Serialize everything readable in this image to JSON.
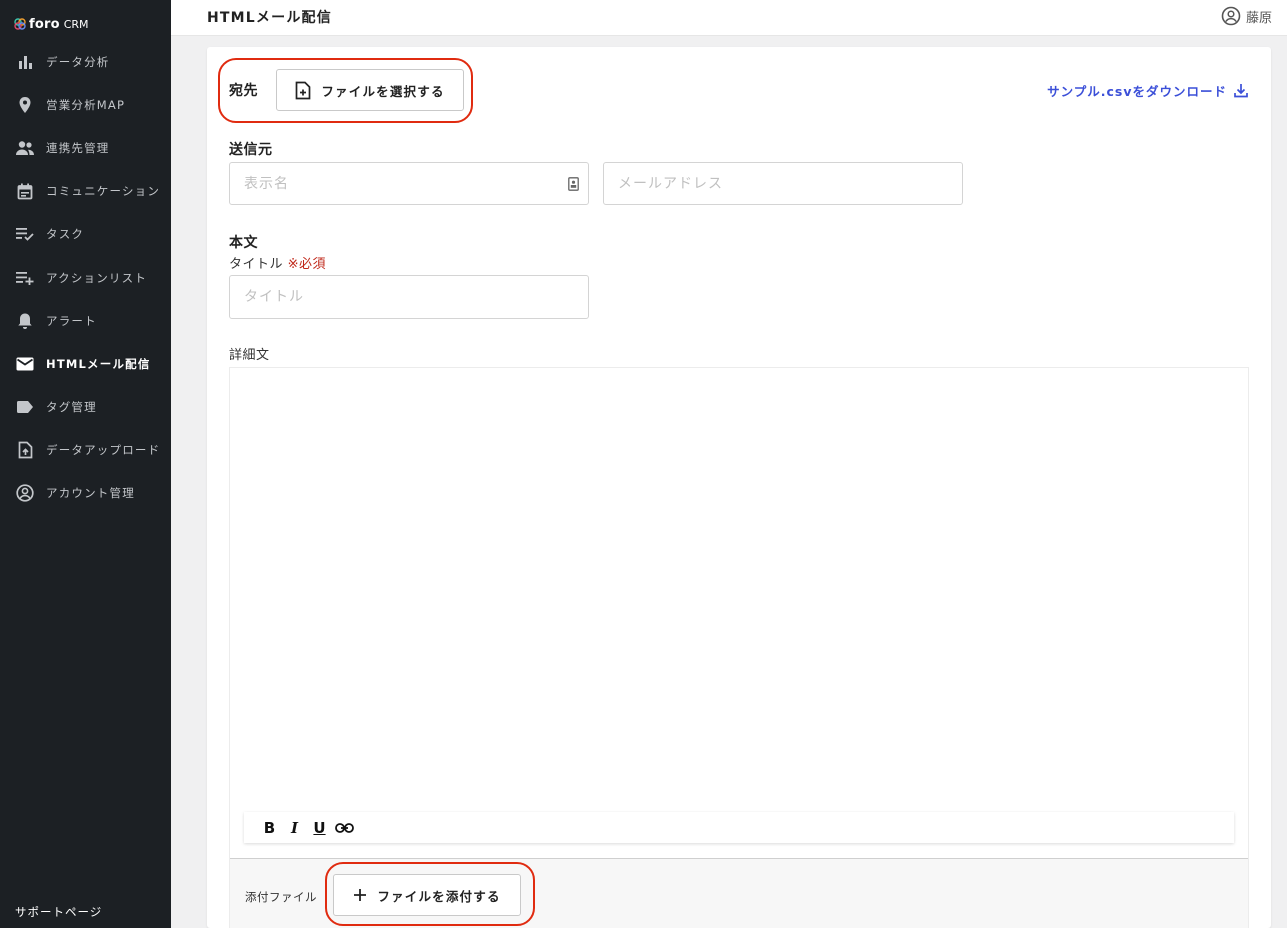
{
  "app": {
    "brand": "foro",
    "brand_suffix": "CRM",
    "accent_color": "#3b4fd8",
    "highlight_color": "#e02b10"
  },
  "sidebar": {
    "items": [
      {
        "label": "データ分析",
        "icon": "bar-chart-icon"
      },
      {
        "label": "営業分析MAP",
        "icon": "map-pin-icon"
      },
      {
        "label": "連携先管理",
        "icon": "people-icon"
      },
      {
        "label": "コミュニケーション",
        "icon": "calendar-icon"
      },
      {
        "label": "タスク",
        "icon": "checklist-icon"
      },
      {
        "label": "アクションリスト",
        "icon": "playlist-add-icon"
      },
      {
        "label": "アラート",
        "icon": "bell-icon"
      },
      {
        "label": "HTMLメール配信",
        "icon": "mail-icon",
        "active": true
      },
      {
        "label": "タグ管理",
        "icon": "tag-icon"
      },
      {
        "label": "データアップロード",
        "icon": "file-upload-icon"
      },
      {
        "label": "アカウント管理",
        "icon": "account-circle-icon"
      }
    ],
    "support_label": "サポートページ"
  },
  "header": {
    "title": "HTMLメール配信",
    "user_name": "藤原"
  },
  "form": {
    "recipient": {
      "label": "宛先",
      "select_button": "ファイルを選択する"
    },
    "sample_download": "サンプル.csvをダウンロード",
    "sender": {
      "label": "送信元",
      "display_name_placeholder": "表示名",
      "email_placeholder": "メールアドレス"
    },
    "body": {
      "label": "本文",
      "title_label": "タイトル",
      "required_mark": "※必須",
      "title_placeholder": "タイトル",
      "detail_label": "詳細文"
    },
    "toolbar": {
      "bold": "B",
      "italic": "I",
      "underline": "U"
    },
    "attachment": {
      "label": "添付ファイル",
      "button": "ファイルを添付する"
    }
  }
}
